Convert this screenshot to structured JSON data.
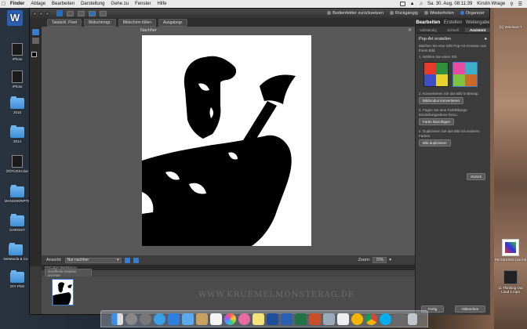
{
  "menubar": {
    "app": "Finder",
    "items": [
      "Ablage",
      "Bearbeiten",
      "Darstellung",
      "Gehe zu",
      "Fenster",
      "Hilfe"
    ],
    "clock": "Sa. 30. Aug. 08:11:39",
    "user": "Kirstin Wrage"
  },
  "titlebar": {
    "undo_fields": "Bedienfelder zurücksetzen",
    "undo": "Rückgängig",
    "redo": "Wiederholen",
    "organizer": "Organizer"
  },
  "optionsbar": {
    "buttons": [
      "Tatsächl. Pixel",
      "Bildschirmgr.",
      "Bildschirm füllen",
      "Ausgabegr."
    ]
  },
  "canvas": {
    "label": "Nachher"
  },
  "infobar": {
    "view_label": "Ansicht:",
    "view_value": "Nur nachher",
    "zoom_label": "Zoom:",
    "zoom_value": "70%"
  },
  "projectbin": {
    "title": "PROJEKTBEREICH",
    "filter": "Geöffnete Dateien anzeige",
    "watermark": "WWW.KRUEMELMONSTERAG.DE"
  },
  "panel": {
    "tabs": [
      "Bearbeiten",
      "Erstellen",
      "Weitergabe"
    ],
    "subtabs": [
      "Vollständig",
      "Schnell",
      "Assistent"
    ],
    "title": "Pop-Art erstellen",
    "intro": "Machen Sie eine tolle Pop-Art-Kreation aus Ihrem Bild.",
    "step1": "1. Wählen Sie einen Stil.",
    "step2": "2. Konvertieren Sie das Bild in Bitmap.",
    "step2_btn": "Bildmodus konvertieren",
    "step3": "3. Fügen Sie eine Farbfüllungs-Einstellungsebene hinzu.",
    "step3_btn": "Farbe hinzufügen",
    "step4": "4. Duplizieren Sie das Bild mit anderen Farben.",
    "step4_btn": "Bild duplizieren",
    "back_btn": "Zurück",
    "done_btn": "Fertig",
    "cancel_btn": "Abbrechen",
    "style_colors": {
      "style1": [
        "#e83a2a",
        "#2f8f3a",
        "#3d4fc7",
        "#e8d32a"
      ],
      "style2": [
        "#e84aa0",
        "#3ab0c9",
        "#7dc240",
        "#c96a2a"
      ]
    }
  },
  "desktop": {
    "icons": [
      "iPhoto",
      "iPhoto",
      "2015",
      "2014",
      "ÖÖTUSSI.doc",
      "MANUSKRIPTE",
      "CHRISSY",
      "DeWanda & Co",
      "DIY Plott"
    ],
    "right_labels": [
      "[C] Windows 7",
      "PE-DESIGN Lite.lnk",
      "11 Thinking Out Loud 1.mp3"
    ]
  },
  "dock": {
    "icons": [
      "finder-icon",
      "launchpad-icon",
      "system-prefs-icon",
      "safari-icon",
      "app-store-icon",
      "mail-icon",
      "contacts-icon",
      "calendar-icon",
      "photos-icon",
      "itunes-icon",
      "notes-icon",
      "photoshop-elements-icon",
      "word-icon",
      "excel-icon",
      "powerpoint-icon",
      "preview-icon",
      "textedit-icon",
      "sketch-icon",
      "chrome-icon",
      "skype-icon",
      "misc-icon",
      "trash-icon"
    ]
  }
}
